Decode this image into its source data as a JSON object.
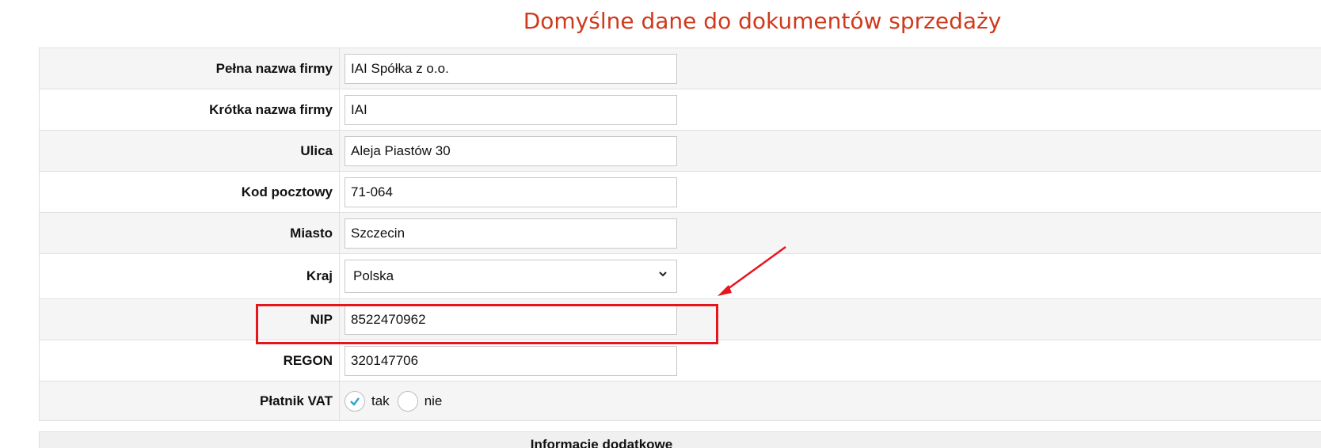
{
  "page_title": "Domyślne dane do dokumentów sprzedaży",
  "fields": {
    "full_name": {
      "label": "Pełna nazwa firmy",
      "value": "IAI Spółka z o.o."
    },
    "short_name": {
      "label": "Krótka nazwa firmy",
      "value": "IAI"
    },
    "street": {
      "label": "Ulica",
      "value": "Aleja Piastów 30"
    },
    "postal_code": {
      "label": "Kod pocztowy",
      "value": "71-064"
    },
    "city": {
      "label": "Miasto",
      "value": "Szczecin"
    },
    "country": {
      "label": "Kraj",
      "value": "Polska"
    },
    "nip": {
      "label": "NIP",
      "value": "8522470962"
    },
    "regon": {
      "label": "REGON",
      "value": "320147706"
    },
    "vat_payer": {
      "label": "Płatnik VAT",
      "option_yes": "tak",
      "option_no": "nie",
      "selected": "tak"
    }
  },
  "additional_info_header": "Informacje dodatkowe",
  "colors": {
    "title": "#d0391b",
    "highlight": "#e8141c",
    "radio_check": "#2aa3d8"
  },
  "icons": [
    "chevron-down-icon",
    "checkmark-icon",
    "arrow-annotation-icon"
  ]
}
